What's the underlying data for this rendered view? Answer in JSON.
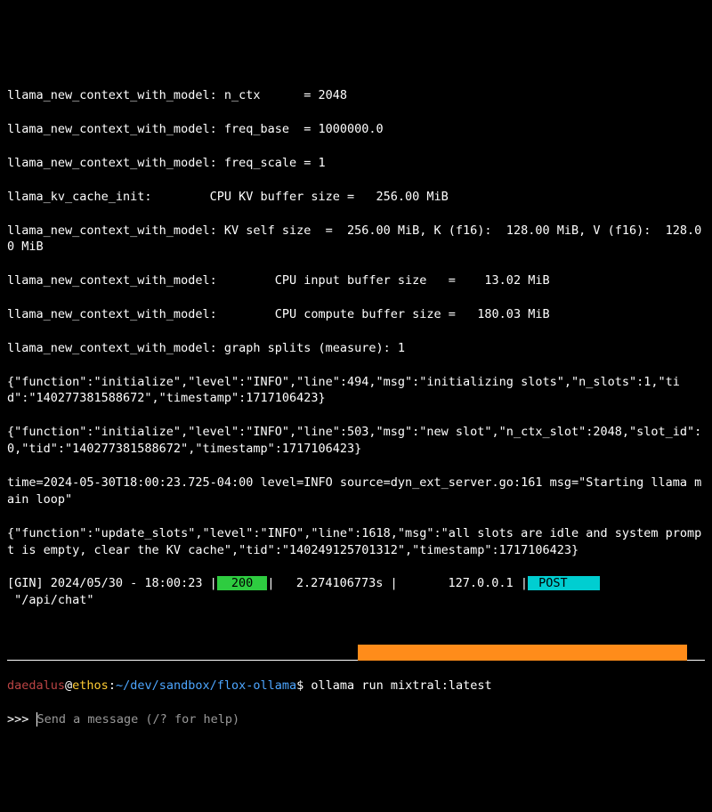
{
  "log_lines": [
    "llama_new_context_with_model: n_ctx      = 2048",
    "llama_new_context_with_model: freq_base  = 1000000.0",
    "llama_new_context_with_model: freq_scale = 1",
    "llama_kv_cache_init:        CPU KV buffer size =   256.00 MiB",
    "llama_new_context_with_model: KV self size  =  256.00 MiB, K (f16):  128.00 MiB, V (f16):  128.00 MiB",
    "llama_new_context_with_model:        CPU input buffer size   =    13.02 MiB",
    "llama_new_context_with_model:        CPU compute buffer size =   180.03 MiB",
    "llama_new_context_with_model: graph splits (measure): 1",
    "{\"function\":\"initialize\",\"level\":\"INFO\",\"line\":494,\"msg\":\"initializing slots\",\"n_slots\":1,\"tid\":\"140277381588672\",\"timestamp\":1717106423}",
    "{\"function\":\"initialize\",\"level\":\"INFO\",\"line\":503,\"msg\":\"new slot\",\"n_ctx_slot\":2048,\"slot_id\":0,\"tid\":\"140277381588672\",\"timestamp\":1717106423}",
    "time=2024-05-30T18:00:23.725-04:00 level=INFO source=dyn_ext_server.go:161 msg=\"Starting llama main loop\"",
    "{\"function\":\"update_slots\",\"level\":\"INFO\",\"line\":1618,\"msg\":\"all slots are idle and system prompt is empty, clear the KV cache\",\"tid\":\"140249125701312\",\"timestamp\":1717106423}"
  ],
  "gin": {
    "prefix": "[GIN] 2024/05/30 - 18:00:23 |",
    "status": " 200 ",
    "mid": "|   2.274106773s |       127.0.0.1 |",
    "method": " POST    ",
    "path": " \"/api/chat\""
  },
  "prompt": {
    "user": "daedalus",
    "at": "@",
    "host": "ethos",
    "colon": ":",
    "path": "~/dev/sandbox/flox-ollama",
    "end": "$ ",
    "command": "ollama run mixtral:latest"
  },
  "repl": {
    "prompt": ">>> ",
    "placeholder": "Send a message (/? for help)"
  }
}
